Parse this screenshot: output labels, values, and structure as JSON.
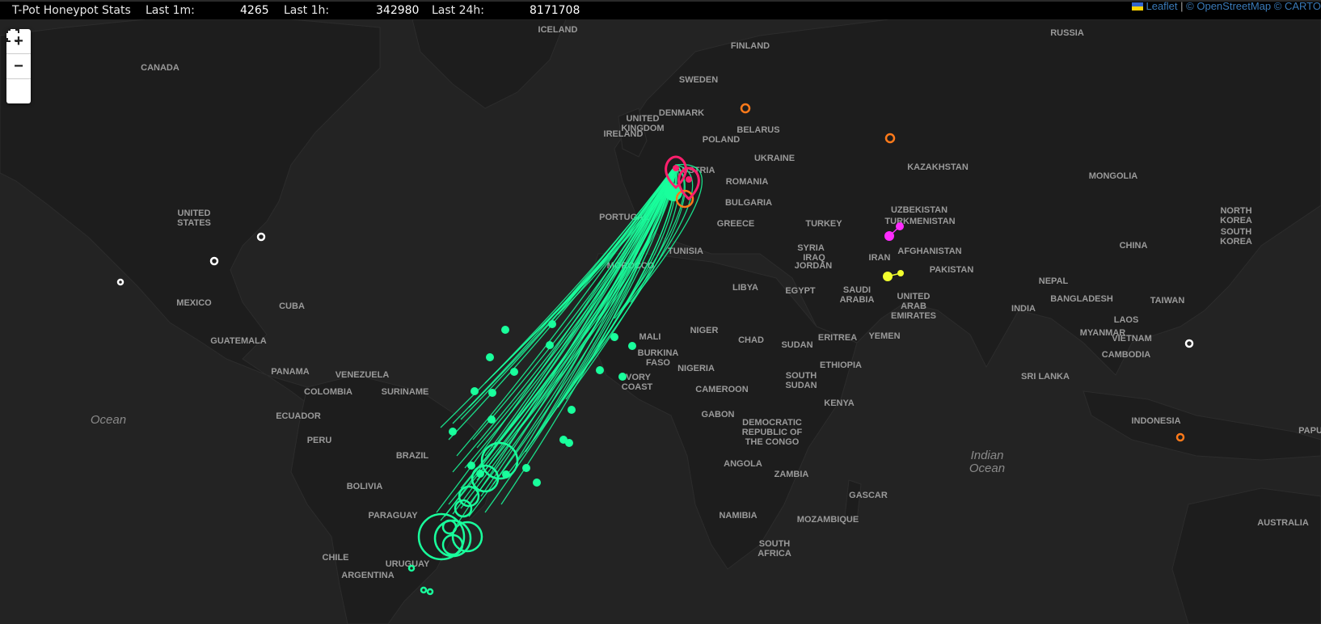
{
  "header": {
    "title": "T-Pot Honeypot Stats",
    "stats": [
      {
        "label": "Last 1m:",
        "value": "4265"
      },
      {
        "label": "Last 1h:",
        "value": "342980"
      },
      {
        "label": "Last 24h:",
        "value": "8171708"
      }
    ]
  },
  "zoom_controls": {
    "zoom_in": "+",
    "zoom_out": "−",
    "fullscreen": "fullscreen-icon"
  },
  "attribution": {
    "leaflet": "Leaflet",
    "separator": "|",
    "osm": "© OpenStreetMap",
    "carto": "© CARTO"
  },
  "colors": {
    "background": "#232323",
    "land": "#1d1d1d",
    "label": "#9a9a9a",
    "attack_arc": "#19ff9c",
    "target_marker": "#ff1f6d",
    "orange_node": "#ff7a1a",
    "magenta_node": "#ff2bff",
    "yellow_node": "#f2ff2e",
    "white_node": "#ffffff"
  },
  "map_labels": {
    "countries": [
      "CANADA",
      "ICELAND",
      "FINLAND",
      "SWEDEN",
      "RUSSIA",
      "DENMARK",
      "UNITED KINGDOM",
      "IRELAND",
      "BELARUS",
      "POLAND",
      "UKRAINE",
      "AUSTRIA",
      "ROMANIA",
      "BULGARIA",
      "KAZAKHSTAN",
      "MONGOLIA",
      "UZBEKISTAN",
      "TURKMENISTAN",
      "NORTH KOREA",
      "SOUTH KOREA",
      "UNITED STATES",
      "PORTUGAL",
      "GREECE",
      "TURKEY",
      "SYRIA",
      "IRAQ",
      "IRAN",
      "AFGHANISTAN",
      "CHINA",
      "JORDAN",
      "PAKISTAN",
      "MOROCCO",
      "TUNISIA",
      "LIBYA",
      "EGYPT",
      "SAUDI ARABIA",
      "UNITED ARAB EMIRATES",
      "NEPAL",
      "BANGLADESH",
      "INDIA",
      "TAIWAN",
      "MEXICO",
      "CUBA",
      "MALI",
      "NIGER",
      "CHAD",
      "SUDAN",
      "ERITREA",
      "YEMEN",
      "MYANMAR",
      "LAOS",
      "VIETNAM",
      "GUATEMALA",
      "BURKINA FASO",
      "IVORY COAST",
      "NIGERIA",
      "ETHIOPIA",
      "SRI LANKA",
      "CAMBODIA",
      "PANAMA",
      "VENEZUELA",
      "COLOMBIA",
      "SURINAME",
      "SOUTH SUDAN",
      "CAMEROON",
      "KENYA",
      "GABON",
      "DEMOCRATIC REPUBLIC OF THE CONGO",
      "INDONESIA",
      "PAPUA",
      "ECUADOR",
      "PERU",
      "BRAZIL",
      "ANGOLA",
      "ZAMBIA",
      "BOLIVIA",
      "PARAGUAY",
      "NAMIBIA",
      "MOZAMBIQUE",
      "MADAGASCAR",
      "AUSTRALIA",
      "SOUTH AFRICA",
      "CHILE",
      "URUGUAY",
      "ARGENTINA"
    ],
    "oceans": [
      "Ocean",
      "Indian Ocean"
    ]
  }
}
